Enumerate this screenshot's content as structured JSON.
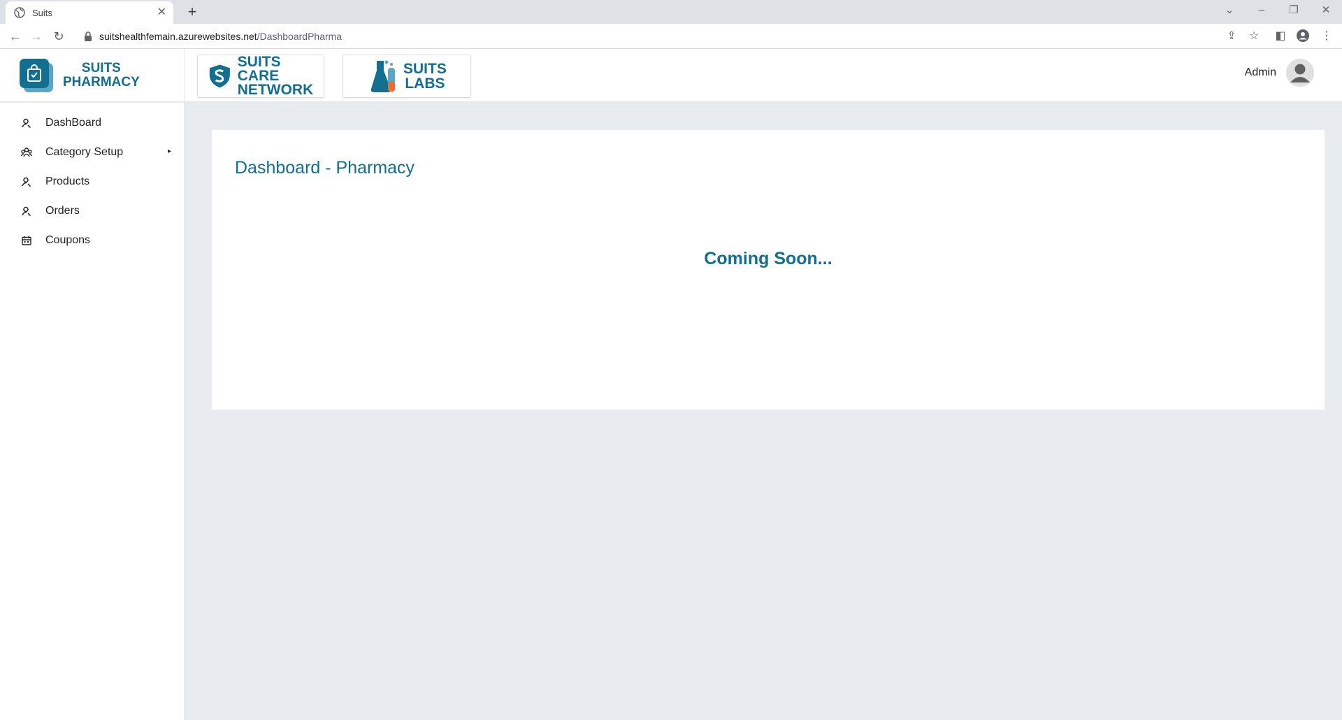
{
  "browser": {
    "tab_title": "Suits",
    "tab_close": "✕",
    "new_tab": "+",
    "url_host": "suitshealthfemain.azurewebsites.net",
    "url_path": "/DashboardPharma",
    "window_controls": {
      "list": "⌄",
      "minimize": "–",
      "restore": "❐",
      "close": "✕"
    }
  },
  "brand": {
    "line1": "SUITS",
    "line2": "PHARMACY",
    "color": "#136f8f"
  },
  "partners": {
    "care": {
      "line1": "SUITS CARE",
      "line2": "NETWORK"
    },
    "labs": {
      "line1": "SUITS",
      "line2": "LABS"
    }
  },
  "user": {
    "name": "Admin"
  },
  "sidebar": {
    "items": [
      {
        "label": "DashBoard",
        "icon": "person-icon"
      },
      {
        "label": "Category Setup",
        "icon": "group-icon",
        "caret": "▸"
      },
      {
        "label": "Products",
        "icon": "person-icon"
      },
      {
        "label": "Orders",
        "icon": "person-icon"
      },
      {
        "label": "Coupons",
        "icon": "calendar-icon"
      }
    ]
  },
  "main": {
    "title": "Dashboard - Pharmacy",
    "message": "Coming Soon..."
  }
}
